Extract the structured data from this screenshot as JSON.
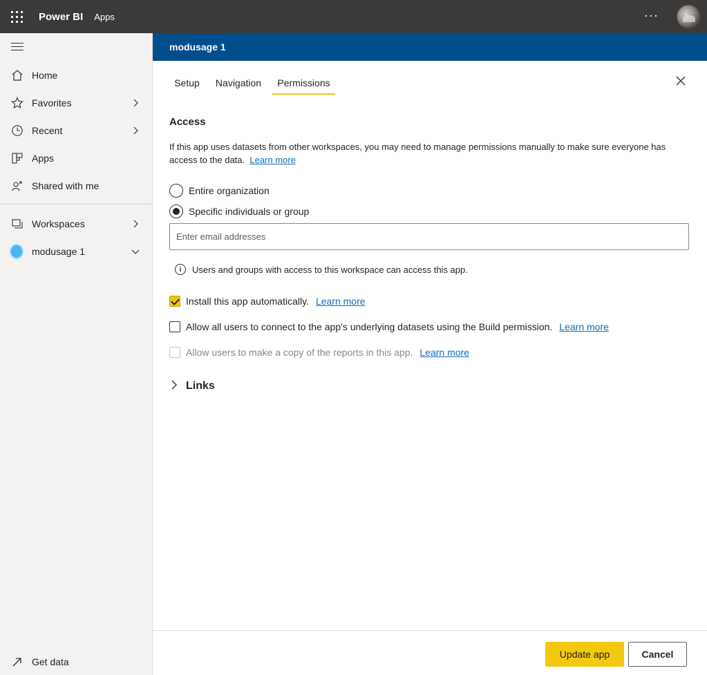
{
  "topbar": {
    "brand": "Power BI",
    "breadcrumb": "Apps",
    "more": "···"
  },
  "nav": {
    "items": [
      {
        "label": "Home"
      },
      {
        "label": "Favorites"
      },
      {
        "label": "Recent"
      },
      {
        "label": "Apps"
      },
      {
        "label": "Shared with me"
      },
      {
        "label": "Workspaces"
      },
      {
        "label": "modusage 1"
      }
    ],
    "get_data": "Get data"
  },
  "header": {
    "title": "modusage 1"
  },
  "tabs": [
    {
      "label": "Setup"
    },
    {
      "label": "Navigation"
    },
    {
      "label": "Permissions",
      "active": true
    }
  ],
  "access": {
    "title": "Access",
    "description": "If this app uses datasets from other workspaces, you may need to manage permissions manually to make sure everyone has access to the data.",
    "learn_more": "Learn more",
    "options": [
      {
        "label": "Entire organization",
        "selected": false
      },
      {
        "label": "Specific individuals or group",
        "selected": true
      }
    ],
    "email_placeholder": "Enter email addresses",
    "info": "Users and groups with access to this workspace can access this app."
  },
  "checks": [
    {
      "label": "Install this app automatically.",
      "checked": true,
      "disabled": false,
      "link": "Learn more"
    },
    {
      "label": "Allow all users to connect to the app's underlying datasets using the Build permission.",
      "checked": false,
      "disabled": false,
      "link": "Learn more"
    },
    {
      "label": "Allow users to make a copy of the reports in this app.",
      "checked": false,
      "disabled": true,
      "link": "Learn more"
    }
  ],
  "links_section": "Links",
  "footer": {
    "primary": "Update app",
    "secondary": "Cancel"
  },
  "colors": {
    "topbar": "#3b3a39",
    "header": "#004e8c",
    "accent": "#f2c811",
    "link": "#0f6cbd"
  }
}
